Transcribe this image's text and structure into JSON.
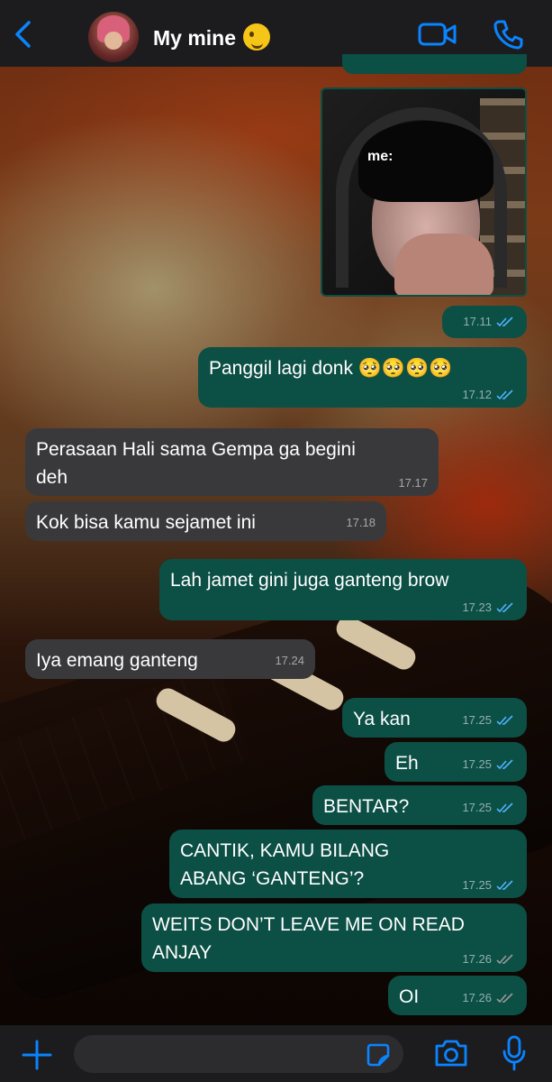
{
  "header": {
    "contact_name": "My mine",
    "emoji": "winking-face-with-tongue"
  },
  "colors": {
    "accent": "#0a84ff",
    "bubble_out": "#0b4f45",
    "bubble_in": "#39393c",
    "read_tick": "#4fb3ff",
    "unread_tick": "#9a9a9a"
  },
  "photo_message": {
    "caption": "me:",
    "time": "17.11"
  },
  "messages": [
    {
      "direction": "out",
      "text": "Panggil lagi donk 🥺🥺🥺🥺",
      "time": "17.12",
      "read": true
    },
    {
      "direction": "in",
      "text": "Perasaan Hali sama Gempa ga begini deh",
      "time": "17.17"
    },
    {
      "direction": "in",
      "text": "Kok bisa kamu sejamet ini",
      "time": "17.18"
    },
    {
      "direction": "out",
      "text": "Lah jamet gini juga ganteng brow",
      "time": "17.23",
      "read": true
    },
    {
      "direction": "in",
      "text": "Iya emang ganteng",
      "time": "17.24"
    },
    {
      "direction": "out",
      "text": "Ya kan",
      "time": "17.25",
      "read": true
    },
    {
      "direction": "out",
      "text": "Eh",
      "time": "17.25",
      "read": true
    },
    {
      "direction": "out",
      "text": "BENTAR?",
      "time": "17.25",
      "read": true
    },
    {
      "direction": "out",
      "text": "CANTIK, KAMU BILANG ABANG ‘GANTENG’?",
      "time": "17.25",
      "read": true
    },
    {
      "direction": "out",
      "text": "WEITS DON’T LEAVE ME ON READ ANJAY",
      "time": "17.26",
      "read": false
    },
    {
      "direction": "out",
      "text": "OI",
      "time": "17.26",
      "read": false
    }
  ],
  "composer": {
    "value": ""
  }
}
